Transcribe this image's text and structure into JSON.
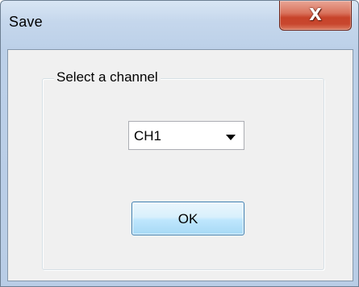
{
  "window": {
    "title": "Save"
  },
  "title_bar": {
    "close_glyph": "X",
    "close_icon": "close-icon"
  },
  "group": {
    "legend": "Select a channel"
  },
  "channel_select": {
    "selected_value": "CH1",
    "arrow_icon": "chevron-down-icon"
  },
  "buttons": {
    "ok_label": "OK"
  },
  "colors": {
    "title_bar": "#c5d7ec",
    "close_button": "#c7432a",
    "dialog_background": "#f0f0f0",
    "ok_button": "#bee6fd"
  }
}
